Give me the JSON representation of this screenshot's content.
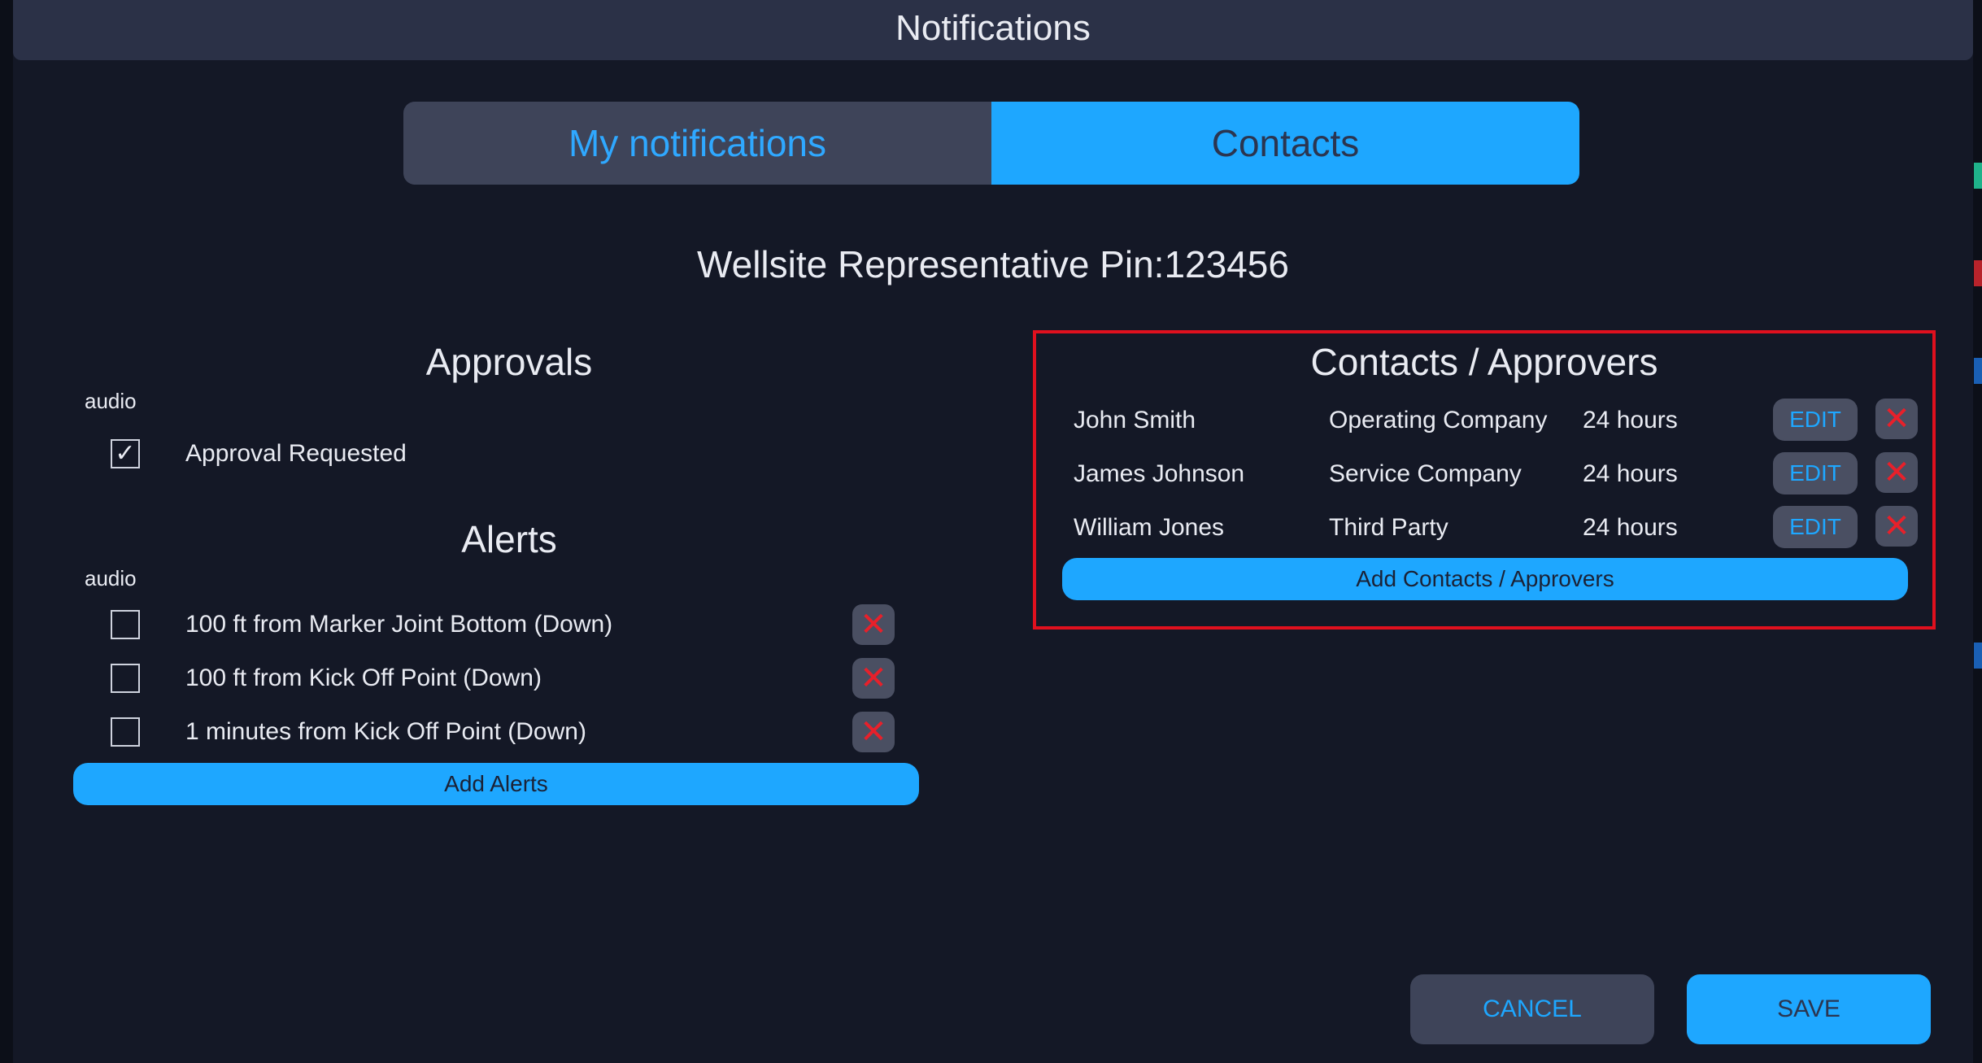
{
  "dialog": {
    "title": "Notifications"
  },
  "tabs": [
    {
      "label": "My notifications",
      "active": false
    },
    {
      "label": "Contacts",
      "active": true
    }
  ],
  "representative": "Wellsite Representative Pin:123456",
  "approvals": {
    "title": "Approvals",
    "audio_label": "audio",
    "items": [
      {
        "label": "Approval Requested",
        "checked": true
      }
    ]
  },
  "alerts": {
    "title": "Alerts",
    "audio_label": "audio",
    "items": [
      {
        "label": "100 ft from Marker Joint Bottom (Down)",
        "checked": false
      },
      {
        "label": "100 ft from Kick Off Point (Down)",
        "checked": false
      },
      {
        "label": "1 minutes from Kick Off Point (Down)",
        "checked": false
      }
    ],
    "add_label": "Add Alerts"
  },
  "contacts": {
    "title": "Contacts / Approvers",
    "rows": [
      {
        "name": "John Smith",
        "company": "Operating Company",
        "window": "24 hours",
        "edit_label": "EDIT"
      },
      {
        "name": "James Johnson",
        "company": "Service Company",
        "window": "24 hours",
        "edit_label": "EDIT"
      },
      {
        "name": "William Jones",
        "company": "Third Party",
        "window": "24 hours",
        "edit_label": "EDIT"
      }
    ],
    "add_label": "Add Contacts / Approvers"
  },
  "footer": {
    "cancel_label": "CANCEL",
    "save_label": "SAVE"
  },
  "icons": {
    "delete": "close-icon",
    "checked": "checkmark-icon"
  },
  "colors": {
    "accent": "#1ea7ff",
    "danger": "#e8202a",
    "highlight": "#e0101e",
    "background": "#141826",
    "titlebar": "#2b3147"
  }
}
